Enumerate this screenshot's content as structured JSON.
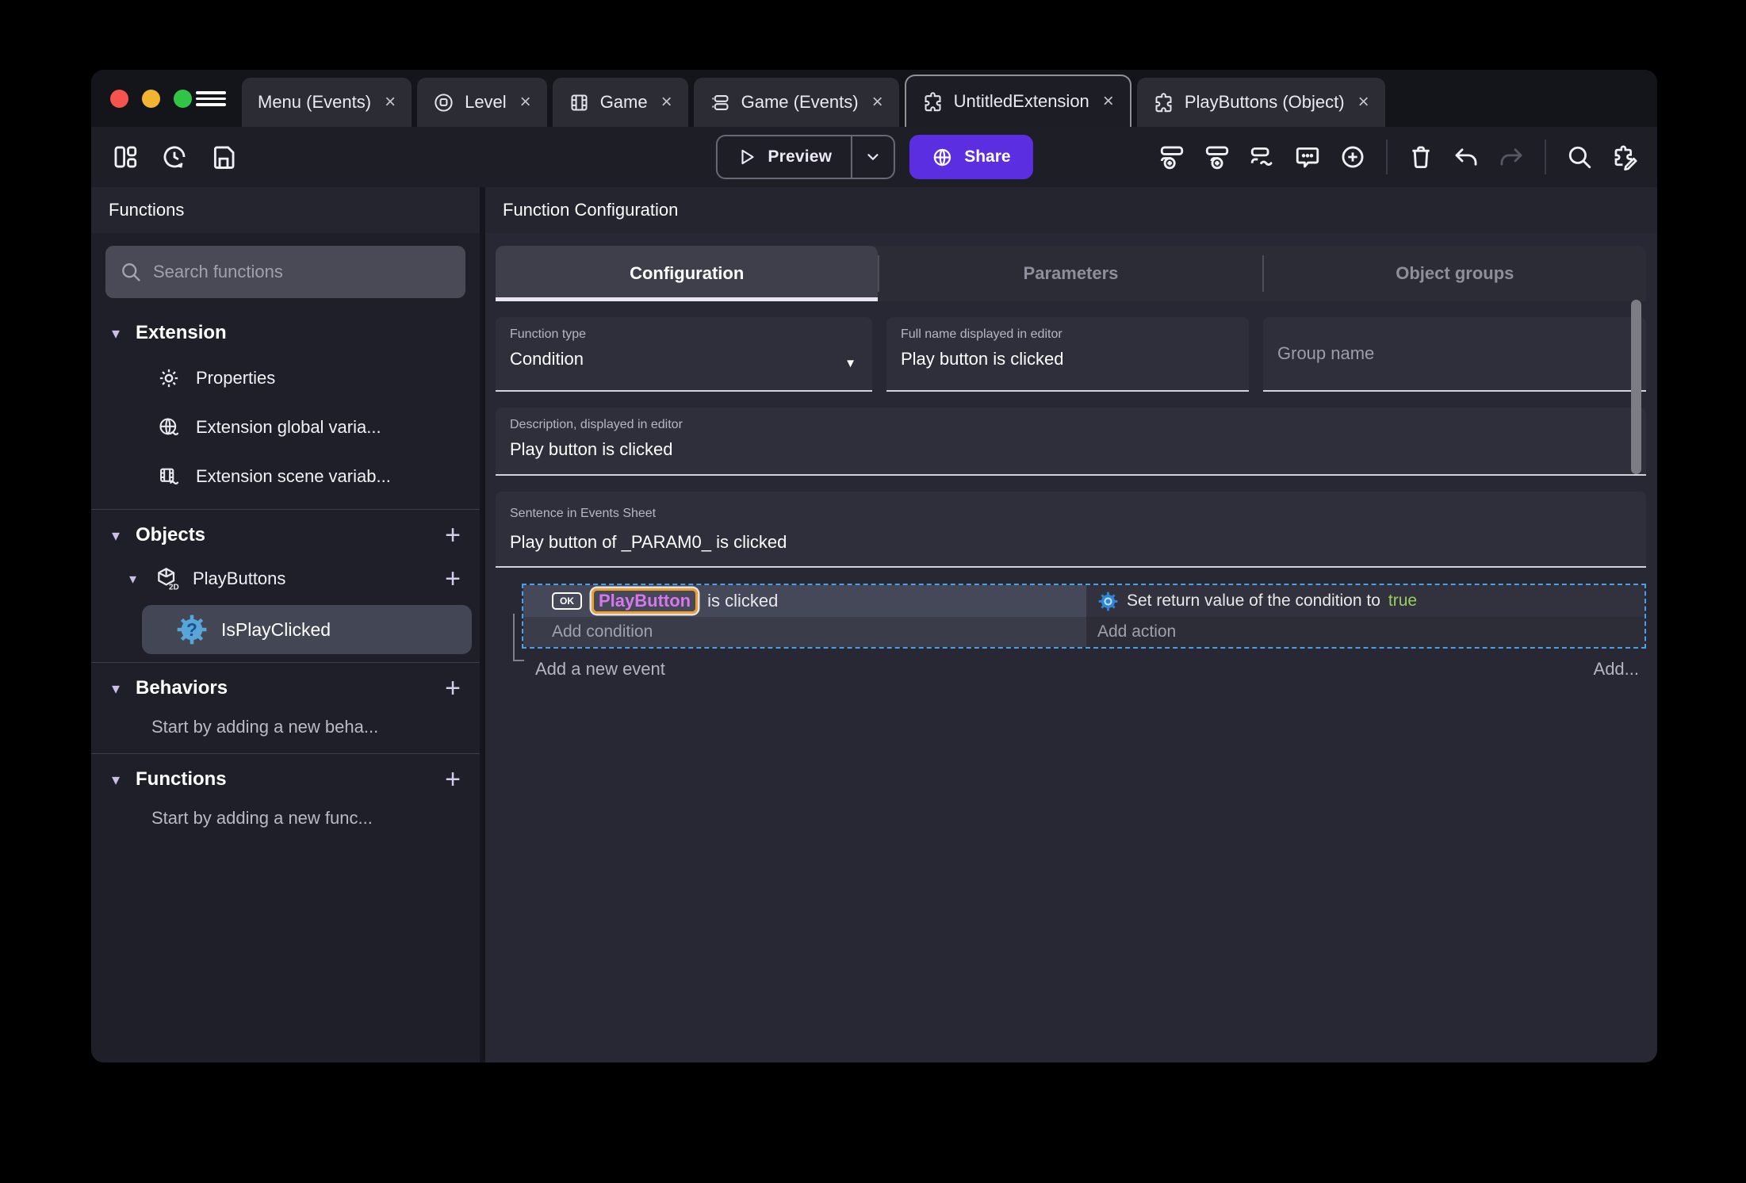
{
  "glyphs": {
    "close": "×",
    "plus": "+",
    "chevron_down": "▾",
    "dropdown_arrow": "▼"
  },
  "window_tabs": {
    "tabs": [
      {
        "label": "Menu (Events)"
      },
      {
        "label": "Level"
      },
      {
        "label": "Game"
      },
      {
        "label": "Game (Events)"
      },
      {
        "label": "UntitledExtension"
      },
      {
        "label": "PlayButtons (Object)"
      }
    ]
  },
  "toolbar": {
    "preview_label": "Preview",
    "share_label": "Share",
    "left_icons": [
      "layout-icon",
      "history-icon",
      "save-icon"
    ],
    "right_icons": [
      "add-event-icon",
      "add-subevent-icon",
      "add-custom-event-icon",
      "comment-icon",
      "add-circle-icon",
      "trash-icon",
      "undo-icon",
      "redo-icon",
      "search-icon",
      "edit-extension-icon"
    ]
  },
  "sidebar": {
    "title": "Functions",
    "search_placeholder": "Search functions",
    "extension": {
      "label": "Extension",
      "items": [
        {
          "label": "Properties",
          "icon": "gear-icon"
        },
        {
          "label": "Extension global varia...",
          "icon": "globe-variable-icon"
        },
        {
          "label": "Extension scene variab...",
          "icon": "scene-variable-icon"
        }
      ]
    },
    "objects": {
      "label": "Objects",
      "object_label": "PlayButtons",
      "function_label": "IsPlayClicked"
    },
    "behaviors": {
      "label": "Behaviors",
      "hint": "Start by adding a new beha..."
    },
    "functions": {
      "label": "Functions",
      "hint": "Start by adding a new func..."
    }
  },
  "main": {
    "title": "Function Configuration",
    "tabs": [
      {
        "label": "Configuration"
      },
      {
        "label": "Parameters"
      },
      {
        "label": "Object groups"
      }
    ],
    "function_type": {
      "label": "Function type",
      "value": "Condition"
    },
    "full_name": {
      "label": "Full name displayed in editor",
      "value": "Play button is clicked"
    },
    "group_name": {
      "placeholder": "Group name"
    },
    "description": {
      "label": "Description, displayed in editor",
      "value": "Play button is clicked"
    },
    "sentence": {
      "label": "Sentence in Events Sheet",
      "value": "Play button of _PARAM0_ is clicked"
    },
    "events": {
      "ok_badge": "OK",
      "condition_object": "PlayButton",
      "condition_text": " is clicked",
      "add_condition": "Add condition",
      "action_text": "Set return value of the condition to ",
      "action_value": "true",
      "add_action": "Add action",
      "add_event": "Add a new event",
      "add_more": "Add..."
    }
  },
  "colors": {
    "accent_purple": "#5b2ee2",
    "selection_blue": "#4aa0e4",
    "true_green": "#9ccc5f",
    "object_highlight": "#d678ea",
    "object_outline": "#ef9f2e"
  }
}
